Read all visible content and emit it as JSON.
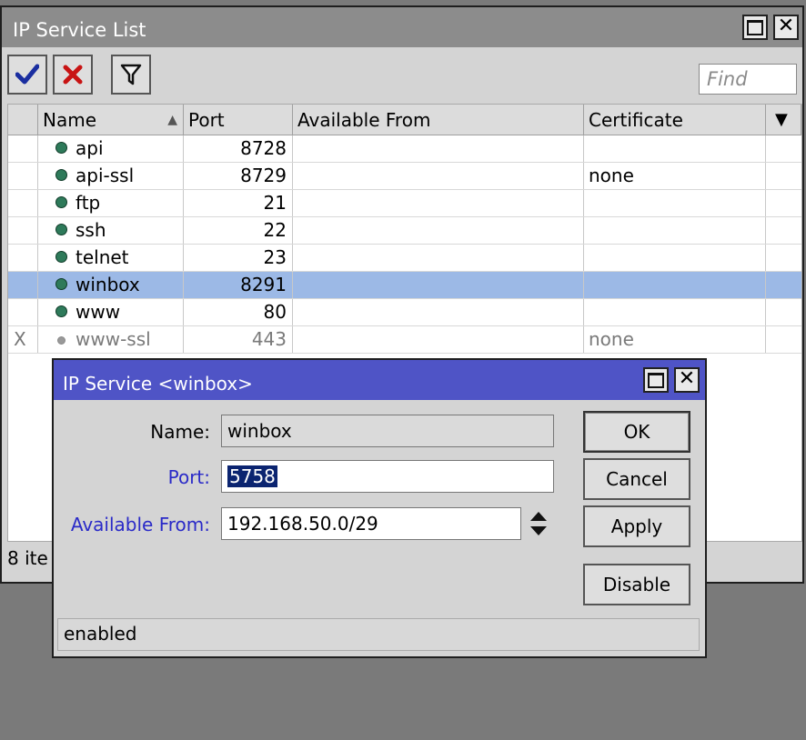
{
  "main_window": {
    "title": "IP Service List",
    "find_placeholder": "Find",
    "status_count": "8 ite"
  },
  "table": {
    "columns": [
      "Name",
      "Port",
      "Available From",
      "Certificate"
    ],
    "rows": [
      {
        "flag": "",
        "name": "api",
        "port": "8728",
        "available_from": "",
        "certificate": ""
      },
      {
        "flag": "",
        "name": "api-ssl",
        "port": "8729",
        "available_from": "",
        "certificate": "none"
      },
      {
        "flag": "",
        "name": "ftp",
        "port": "21",
        "available_from": "",
        "certificate": ""
      },
      {
        "flag": "",
        "name": "ssh",
        "port": "22",
        "available_from": "",
        "certificate": ""
      },
      {
        "flag": "",
        "name": "telnet",
        "port": "23",
        "available_from": "",
        "certificate": ""
      },
      {
        "flag": "",
        "name": "winbox",
        "port": "8291",
        "available_from": "",
        "certificate": ""
      },
      {
        "flag": "",
        "name": "www",
        "port": "80",
        "available_from": "",
        "certificate": ""
      },
      {
        "flag": "X",
        "name": "www-ssl",
        "port": "443",
        "available_from": "",
        "certificate": "none"
      }
    ]
  },
  "dialog": {
    "title": "IP Service <winbox>",
    "name_label": "Name:",
    "name_value": "winbox",
    "port_label": "Port:",
    "port_value": "5758",
    "available_label": "Available From:",
    "available_value": "192.168.50.0/29",
    "ok_label": "OK",
    "cancel_label": "Cancel",
    "apply_label": "Apply",
    "disable_label": "Disable",
    "status": "enabled"
  },
  "colors": {
    "dialog_titlebar": "#4f54c6",
    "selected_row": "#9cb9e6",
    "label_blue": "#2a2ac8",
    "enabled_dot": "#2e7a5a"
  }
}
